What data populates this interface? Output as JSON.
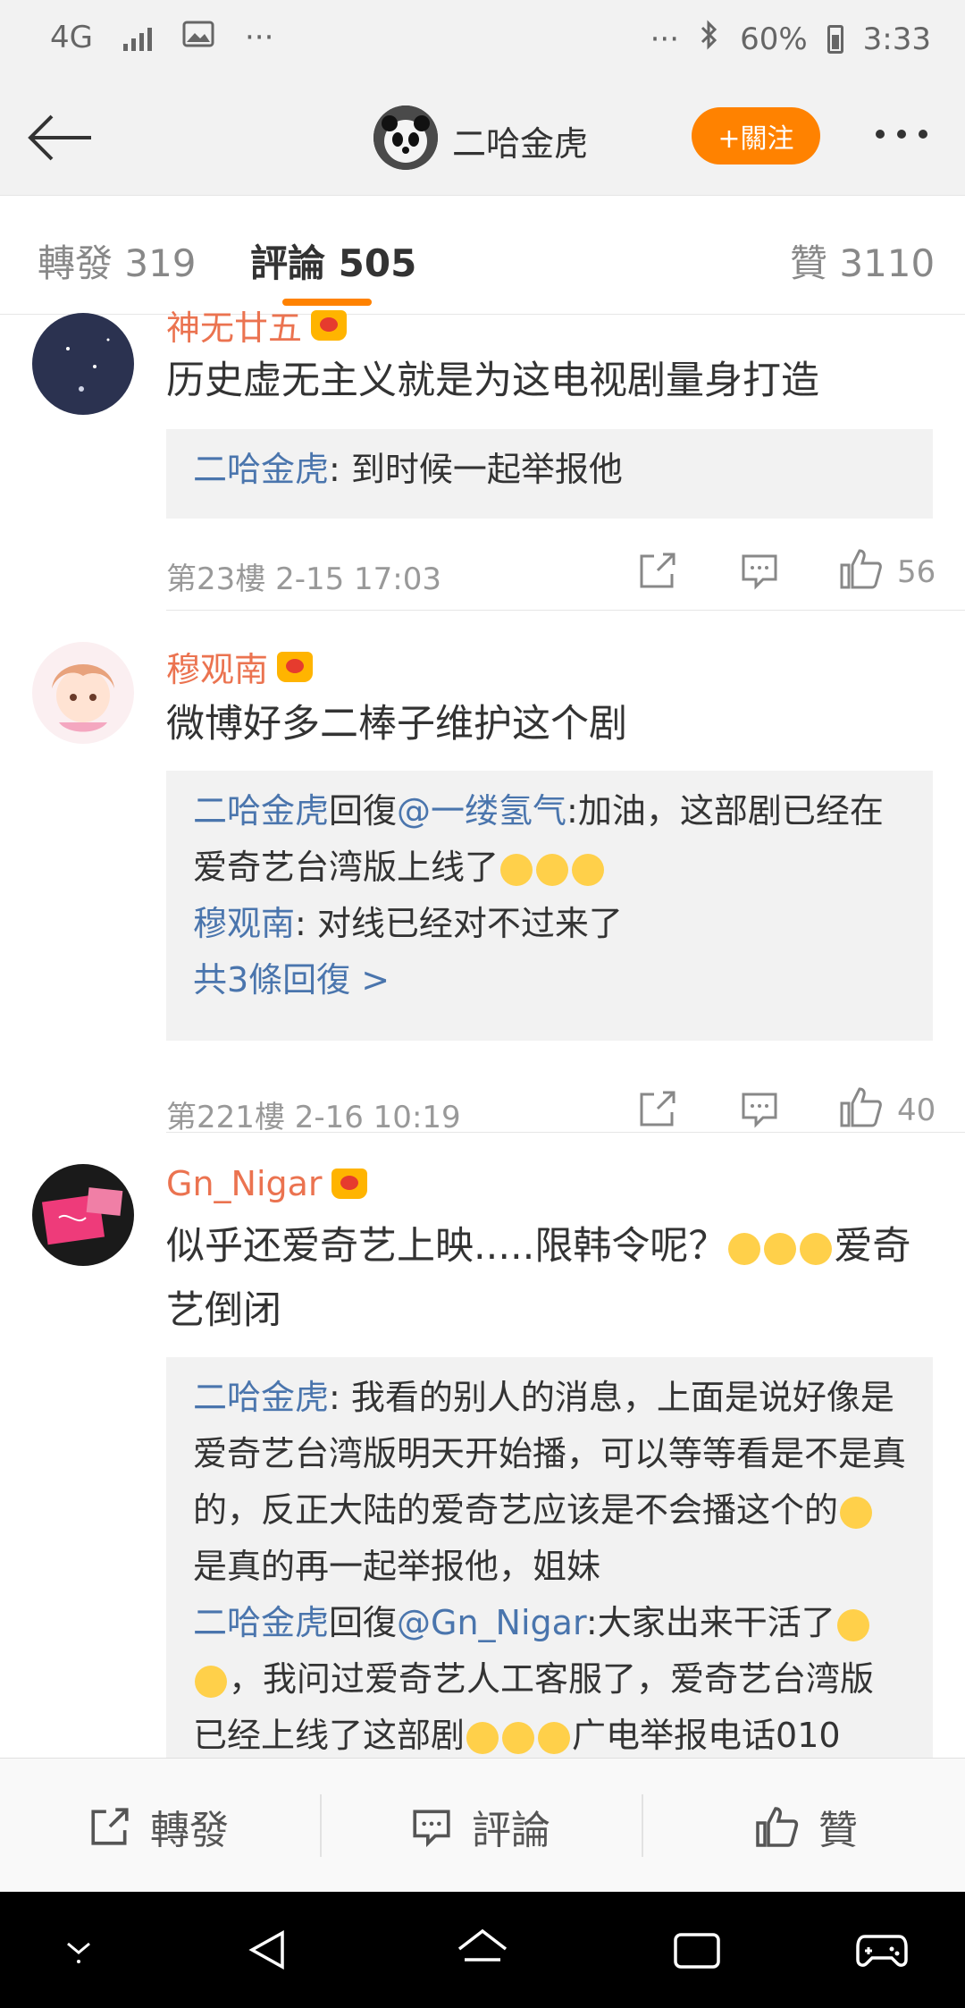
{
  "status_bar": {
    "network": "4G",
    "overflow_left": "···",
    "overflow_right": "···",
    "battery": "60%",
    "time": "3:33"
  },
  "header": {
    "title": "二哈金虎",
    "follow_label": "+關注"
  },
  "tabs": [
    {
      "label": "轉發 319"
    },
    {
      "label": "評論 505",
      "active": true
    },
    {
      "label": "贊 3110"
    }
  ],
  "comments": [
    {
      "username": "神无廿五",
      "text": "历史虚无主义就是为这电视剧量身打造",
      "replies": [
        {
          "author": "二哈金虎",
          "text": ": 到时候一起举报他"
        }
      ],
      "floor": "第23樓 2-15 17:03",
      "likes": "56"
    },
    {
      "username": "穆观南",
      "text": "微博好多二棒子维护这个剧",
      "replies": [
        {
          "author": "二哈金虎",
          "reply_word": "回復",
          "mention": "@一缕氢气",
          "text": ":加油，这部剧已经在爱奇艺台湾版上线了"
        },
        {
          "author": "穆观南",
          "text": ": 对线已经对不过来了"
        }
      ],
      "more_replies": "共3條回復 >",
      "floor": "第221樓 2-16 10:19",
      "likes": "40"
    },
    {
      "username": "Gn_Nigar",
      "text_a": "似乎还爱奇艺上映.....限韩令呢？",
      "text_b": "爱奇艺倒闭",
      "replies": [
        {
          "author": "二哈金虎",
          "text_a": ": 我看的别人的消息，上面是说好像是爱奇艺台湾版明天开始播，可以等等看是不是真的，反正大陆的爱奇艺应该是不会播这个的",
          "text_b": "是真的再一起举报他，姐妹"
        },
        {
          "author": "二哈金虎",
          "reply_word": "回復",
          "mention": "@Gn_Nigar",
          "text_a": ":大家出来干活了",
          "text_b": "，我问过爱奇艺人工客服了，爱奇艺台湾版已经上线了这部剧",
          "text_c": "广电举报电话010"
        }
      ]
    }
  ],
  "action_bar": {
    "repost": "轉發",
    "comment": "評論",
    "like": "贊"
  },
  "colors": {
    "accent": "#ff8200",
    "username": "#eb7350",
    "link": "#4a75ad"
  }
}
